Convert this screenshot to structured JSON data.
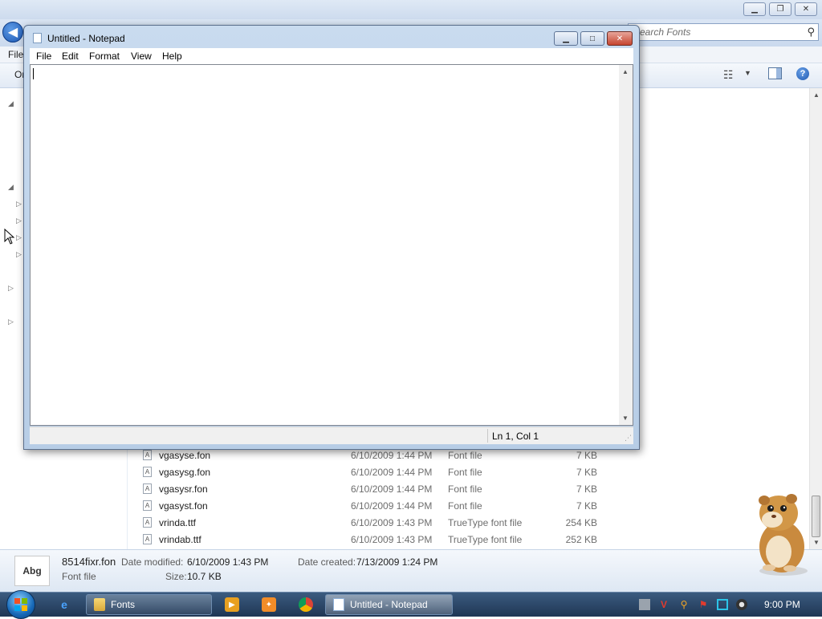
{
  "explorer": {
    "search_placeholder": "Search Fonts",
    "menu_file": "File",
    "toolbar_organize": "Organize",
    "files": [
      {
        "name": "vgasyse.fon",
        "date": "6/10/2009 1:44 PM",
        "type": "Font file",
        "size": "7 KB"
      },
      {
        "name": "vgasysg.fon",
        "date": "6/10/2009 1:44 PM",
        "type": "Font file",
        "size": "7 KB"
      },
      {
        "name": "vgasysr.fon",
        "date": "6/10/2009 1:44 PM",
        "type": "Font file",
        "size": "7 KB"
      },
      {
        "name": "vgasyst.fon",
        "date": "6/10/2009 1:44 PM",
        "type": "Font file",
        "size": "7 KB"
      },
      {
        "name": "vrinda.ttf",
        "date": "6/10/2009 1:43 PM",
        "type": "TrueType font file",
        "size": "254 KB"
      },
      {
        "name": "vrindab.ttf",
        "date": "6/10/2009 1:43 PM",
        "type": "TrueType font file",
        "size": "252 KB"
      }
    ],
    "details": {
      "thumb_text": "Abg",
      "filename": "8514fixr.fon",
      "filetype": "Font file",
      "modified_label": "Date modified:",
      "modified_value": "6/10/2009 1:43 PM",
      "created_label": "Date created:",
      "created_value": "7/13/2009 1:24 PM",
      "size_label": "Size:",
      "size_value": "10.7 KB"
    }
  },
  "notepad": {
    "title": "Untitled - Notepad",
    "menu": [
      "File",
      "Edit",
      "Format",
      "View",
      "Help"
    ],
    "status_position": "Ln 1, Col 1",
    "content": ""
  },
  "taskbar": {
    "buttons": [
      {
        "label": "Fonts",
        "icon": "folder-icon"
      },
      {
        "label": "Untitled - Notepad",
        "icon": "notepad-icon"
      }
    ],
    "pinned": [
      "internet-explorer-icon",
      "media-player-icon",
      "vlc-icon",
      "chrome-icon"
    ],
    "tray": [
      "network-icon",
      "antivirus-icon",
      "search-tool-icon",
      "flag-icon",
      "display-icon",
      "volume-icon"
    ],
    "clock": "9:00 PM"
  },
  "colors": {
    "taskbar": "#2a4566",
    "title_gradient": "#c9dbef",
    "close_button": "#c6452f"
  }
}
